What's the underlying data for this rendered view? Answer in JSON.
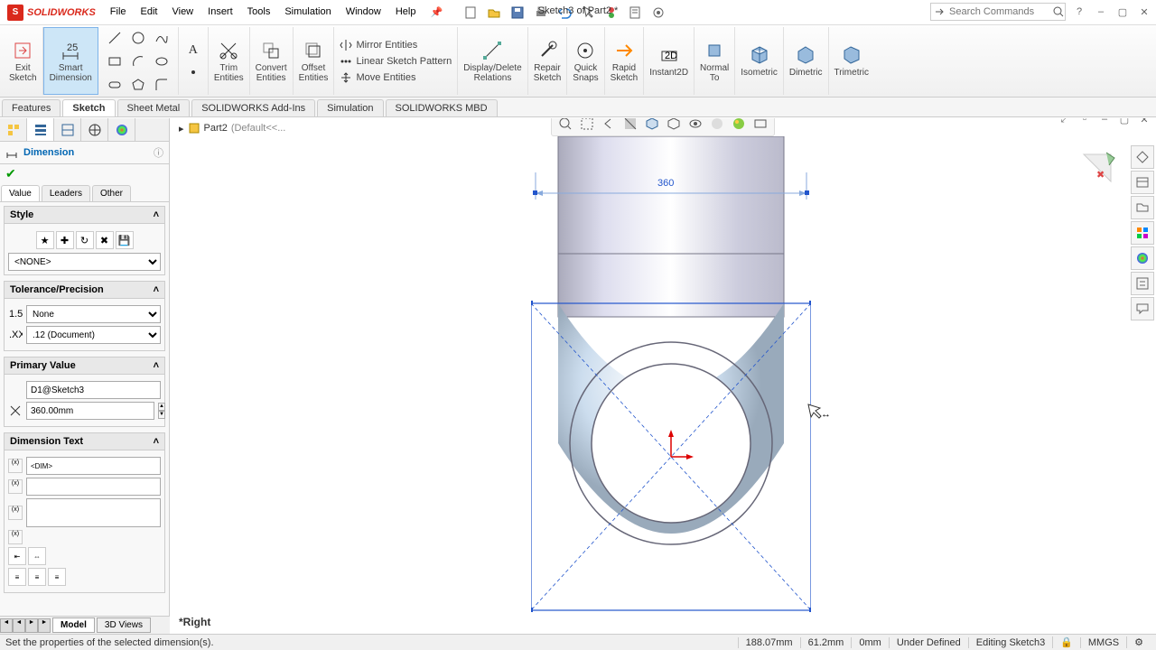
{
  "app": {
    "name": "SOLIDWORKS",
    "doc_title": "Sketch3 of Part2 *"
  },
  "menus": [
    "File",
    "Edit",
    "View",
    "Insert",
    "Tools",
    "Simulation",
    "Window",
    "Help"
  ],
  "search": {
    "placeholder": "Search Commands"
  },
  "ribbon": {
    "exit_sketch": "Exit\nSketch",
    "smart_dimension": "Smart\nDimension",
    "trim": "Trim\nEntities",
    "convert": "Convert\nEntities",
    "offset": "Offset\nEntities",
    "mirror": "Mirror Entities",
    "pattern": "Linear Sketch Pattern",
    "move": "Move Entities",
    "display_delete": "Display/Delete\nRelations",
    "repair": "Repair\nSketch",
    "quick_snaps": "Quick\nSnaps",
    "rapid": "Rapid\nSketch",
    "instant2d": "Instant2D",
    "normal_to": "Normal\nTo",
    "isometric": "Isometric",
    "dimetric": "Dimetric",
    "trimetric": "Trimetric"
  },
  "tabs": [
    "Features",
    "Sketch",
    "Sheet Metal",
    "SOLIDWORKS Add-Ins",
    "Simulation",
    "SOLIDWORKS MBD"
  ],
  "active_tab": "Sketch",
  "breadcrumb": {
    "part": "Part2",
    "config": "(Default<<..."
  },
  "pm": {
    "title": "Dimension",
    "tabs": [
      "Value",
      "Leaders",
      "Other"
    ],
    "active_tab": "Value",
    "style": {
      "head": "Style",
      "value": "<NONE>"
    },
    "tol": {
      "head": "Tolerance/Precision",
      "type": "None",
      "precision": ".12 (Document)"
    },
    "primary": {
      "head": "Primary Value",
      "name": "D1@Sketch3",
      "value": "360.00mm"
    },
    "dimtext": {
      "head": "Dimension Text",
      "value": "<DIM>"
    }
  },
  "graphics": {
    "dimension": "360",
    "orientation": "*Right"
  },
  "bottom_tabs": [
    "Model",
    "3D Views"
  ],
  "status": {
    "hint": "Set the properties of the selected dimension(s).",
    "x": "188.07mm",
    "y": "61.2mm",
    "z": "0mm",
    "state": "Under Defined",
    "editing": "Editing Sketch3",
    "units": "MMGS"
  }
}
